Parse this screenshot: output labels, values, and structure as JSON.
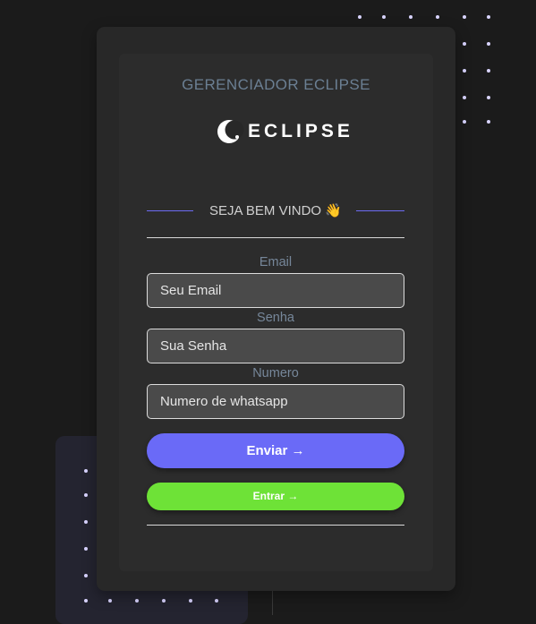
{
  "header": {
    "title": "GERENCIADOR ECLIPSE"
  },
  "logo": {
    "text": "ECLIPSE"
  },
  "welcome": {
    "text": "SEJA BEM VINDO 👋"
  },
  "form": {
    "email": {
      "label": "Email",
      "placeholder": "Seu Email"
    },
    "password": {
      "label": "Senha",
      "placeholder": "Sua Senha"
    },
    "phone": {
      "label": "Numero",
      "placeholder": "Numero de whatsapp"
    },
    "send_button": "Enviar →",
    "enter_button": "Entrar →"
  },
  "colors": {
    "accent": "#6a6af7",
    "success": "#6ee237",
    "background": "#1b1b1b",
    "card": "#282828"
  }
}
